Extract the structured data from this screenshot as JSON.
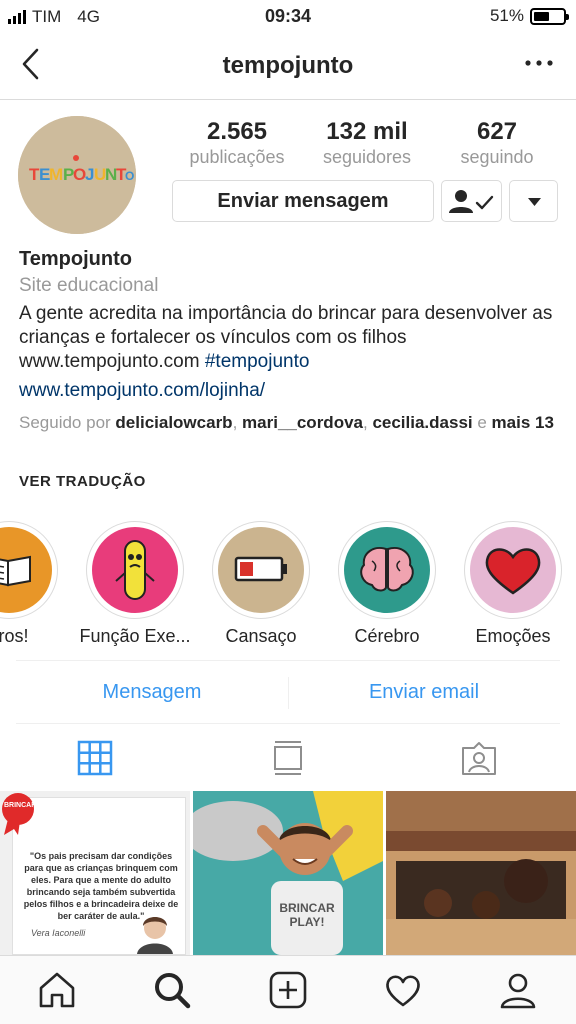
{
  "status_bar": {
    "carrier": "TIM",
    "network": "4G",
    "time": "09:34",
    "battery": "51%"
  },
  "nav": {
    "title": "tempojunto"
  },
  "avatar_text": "TEMPOJUNTO",
  "stats": [
    {
      "value": "2.565",
      "label": "publicações"
    },
    {
      "value": "132 mil",
      "label": "seguidores"
    },
    {
      "value": "627",
      "label": "seguindo"
    }
  ],
  "buttons": {
    "message": "Enviar mensagem"
  },
  "bio": {
    "name": "Tempojunto",
    "category": "Site educacional",
    "text": "A gente acredita na importância do brincar para desenvolver as crianças e fortalecer os vínculos com os filhos www.tempojunto.com ",
    "hashtag": "#tempojunto",
    "link": "www.tempojunto.com/lojinha/",
    "followed_prefix": "Seguido por ",
    "followed_users": [
      "delicialowcarb",
      "mari__cordova",
      "cecilia.dassi"
    ],
    "followed_suffix_e": " e ",
    "followed_more": "mais 13",
    "translate": "VER TRADUÇÃO"
  },
  "highlights": [
    {
      "label": "vros!",
      "color": "#e89628"
    },
    {
      "label": "Função Exe...",
      "color": "#e83c7b"
    },
    {
      "label": "Cansaço",
      "color": "#cbb48f"
    },
    {
      "label": "Cérebro",
      "color": "#2e9a8c"
    },
    {
      "label": "Emoções",
      "color": "#e6b8d3"
    }
  ],
  "contact": {
    "message": "Mensagem",
    "email": "Enviar email"
  },
  "grid": {
    "post1_badge": "BRINCAR",
    "post1_quote": "\"Os pais precisam dar condições para que as crianças brinquem com eles. Para que a mente do adulto brincando seja também subvertida pelos filhos e a brincadeira deixe de ber caráter de aula.\"",
    "post1_author": "Vera Iaconelli",
    "post2_shirt": "BRINCAR PLAY!"
  },
  "colors": {
    "accent": "#3897f0",
    "link": "#003569",
    "muted": "#999999"
  }
}
